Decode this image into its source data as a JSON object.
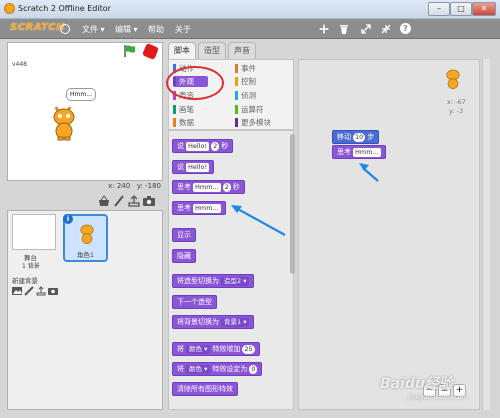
{
  "window": {
    "title": "Scratch 2 Offline Editor",
    "controls": {
      "minimize": "–",
      "maximize": "□",
      "close": "✕"
    }
  },
  "menubar": {
    "logo": "SCRATCH",
    "items": [
      {
        "label": "文件",
        "arrow": "▾"
      },
      {
        "label": "编辑",
        "arrow": "▾"
      },
      {
        "label": "帮助"
      },
      {
        "label": "关于"
      }
    ]
  },
  "stage": {
    "version": "v448",
    "speech": "Hmm...",
    "coords": {
      "x_label": "x:",
      "x": "240",
      "y_label": "y:",
      "y": "-180"
    }
  },
  "sprites": {
    "stage_label": "舞台",
    "backdrop_count": "1 背景",
    "new_backdrop_label": "新建背景",
    "sprite_name": "角色1"
  },
  "tabs": [
    {
      "label": "脚本"
    },
    {
      "label": "造型"
    },
    {
      "label": "声音"
    }
  ],
  "categories": [
    {
      "label": "动作",
      "color": "#4a6cd4"
    },
    {
      "label": "事件",
      "color": "#c88330"
    },
    {
      "label": "外观",
      "color": "#8a55d7"
    },
    {
      "label": "控制",
      "color": "#e1a91a"
    },
    {
      "label": "声音",
      "color": "#bb42c3"
    },
    {
      "label": "侦测",
      "color": "#2ca5e2"
    },
    {
      "label": "画笔",
      "color": "#0e9a6c"
    },
    {
      "label": "运算符",
      "color": "#5cb712"
    },
    {
      "label": "数据",
      "color": "#ee7d16"
    },
    {
      "label": "更多模块",
      "color": "#632d99"
    }
  ],
  "palette": {
    "say_timed": {
      "label": "说",
      "text": "Hello!",
      "secs": "2",
      "unit": "秒"
    },
    "say": {
      "label": "说",
      "text": "Hello!"
    },
    "think_timed": {
      "label": "思考",
      "text": "Hmm...",
      "secs": "2",
      "unit": "秒"
    },
    "think": {
      "label": "思考",
      "text": "Hmm..."
    },
    "show": "显示",
    "hide": "隐藏",
    "switch_costume": {
      "label": "将造型切换为",
      "value": "造型2"
    },
    "next_costume": "下一个造型",
    "switch_backdrop": {
      "label": "将背景切换为",
      "value": "背景1"
    },
    "change_effect": {
      "label": "将",
      "effect": "颜色",
      "mid": "特效增加",
      "value": "25"
    },
    "set_effect": {
      "label": "将",
      "effect": "颜色",
      "mid": "特效设定为",
      "value": "0"
    },
    "clear_effects": "清除所有图形特效"
  },
  "scripts": {
    "sprite_x": "x: -67",
    "sprite_y": "y: -3",
    "move_block": {
      "label": "移动",
      "value": "10",
      "unit": "步"
    },
    "think_block": {
      "label": "思考",
      "text": "Hmm..."
    }
  },
  "zoom": {
    "out": "−",
    "reset": "=",
    "in": "+"
  },
  "watermark": "Baidu经验",
  "watermark_url": "jingyan.baidu.com",
  "colors": {
    "looks": "#8a55d7",
    "motion": "#4a6cd4",
    "annotation_red": "#e02d35",
    "annotation_blue": "#1e88e5"
  }
}
